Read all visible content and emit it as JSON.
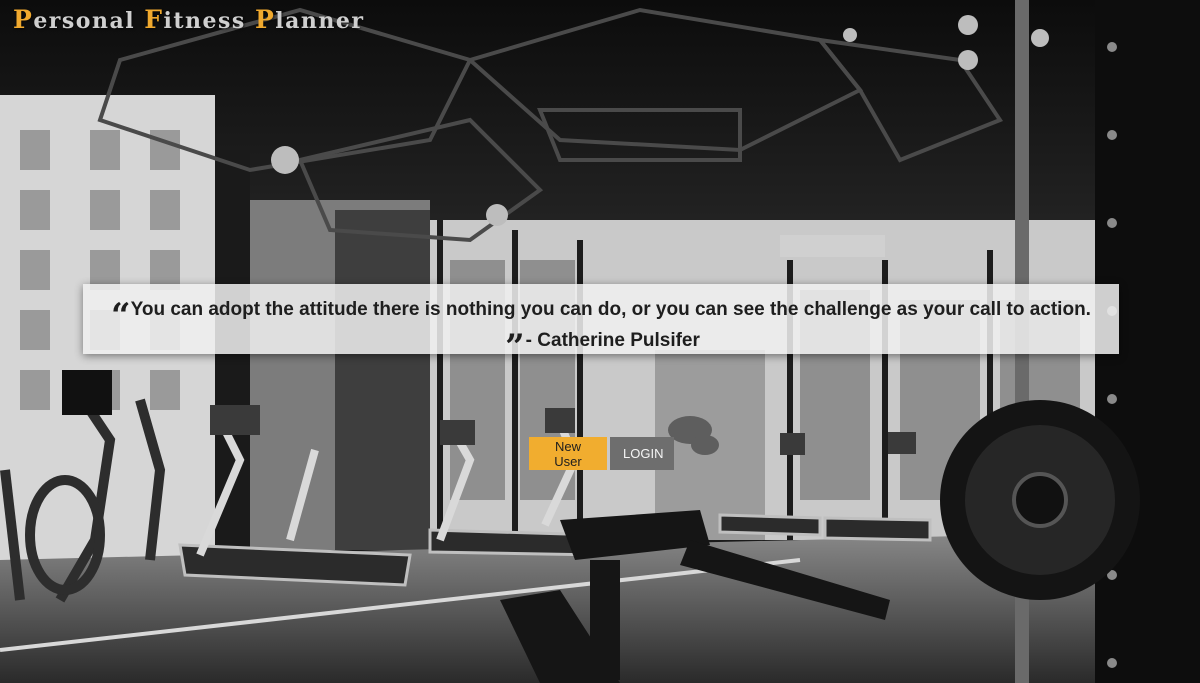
{
  "header": {
    "title_parts": [
      {
        "cap": "P",
        "rest": "ersonal "
      },
      {
        "cap": "F",
        "rest": "itness "
      },
      {
        "cap": "P",
        "rest": "lanner"
      }
    ]
  },
  "hero": {
    "background": "black-and-white gym interior photo",
    "quote": {
      "text": "You can adopt the attitude there is nothing you can do, or you can see the challenge as your call to action.",
      "author": "- Catherine Pulsifer",
      "open_icon": "quote-open-icon",
      "close_icon": "quote-close-icon"
    }
  },
  "actions": {
    "new_user_label": "New User",
    "login_label": "LOGIN"
  },
  "colors": {
    "accent": "#f1ad2f",
    "login_button": "#6e6e6e",
    "quote_box": "#f0f0f0"
  }
}
